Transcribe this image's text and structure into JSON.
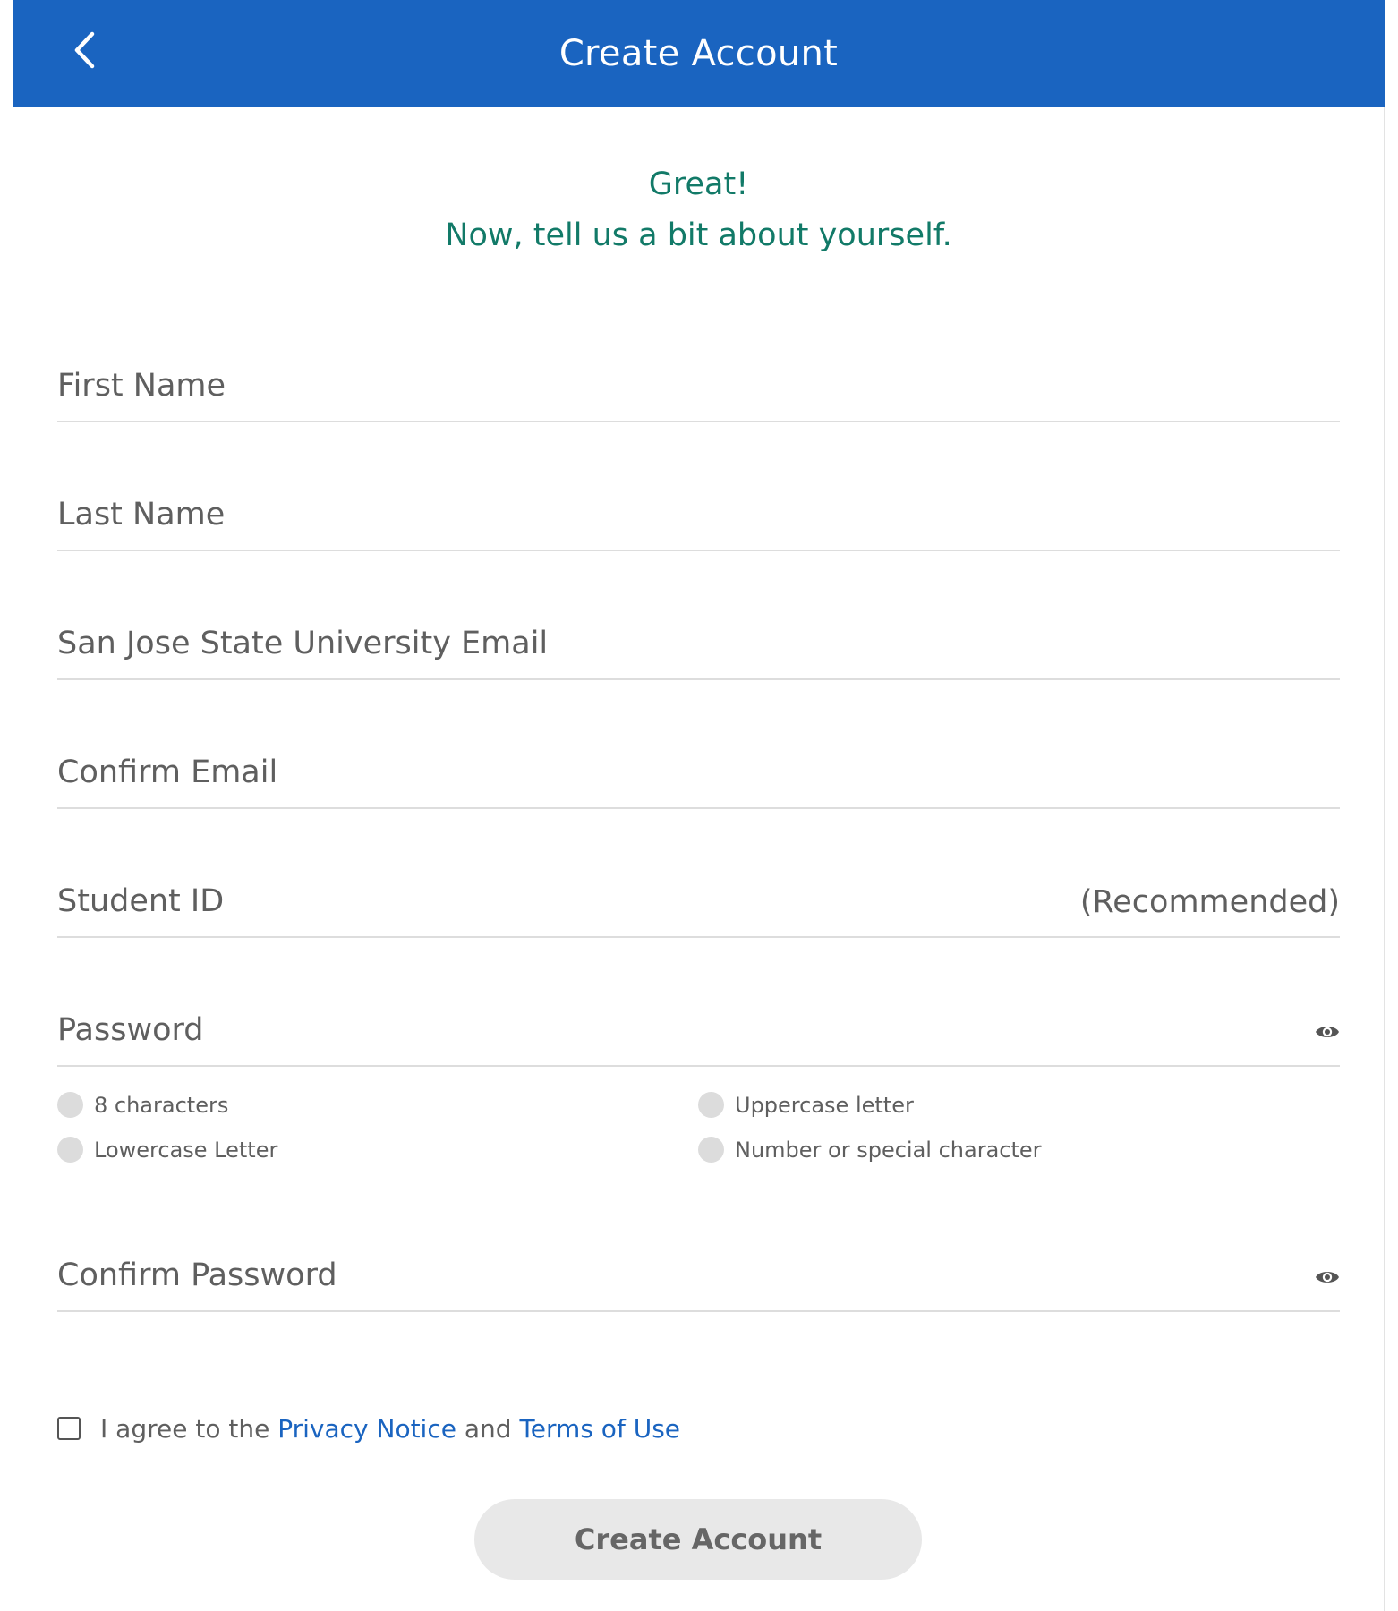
{
  "header": {
    "title": "Create Account",
    "back_icon": "chevron-left-icon",
    "background_color": "#1a64c0"
  },
  "intro": {
    "line1": "Great!",
    "line2": "Now, tell us a bit about yourself.",
    "color": "#127a68"
  },
  "form": {
    "first_name": {
      "placeholder": "First Name",
      "value": ""
    },
    "last_name": {
      "placeholder": "Last Name",
      "value": ""
    },
    "email": {
      "placeholder": "San Jose State University Email",
      "value": ""
    },
    "confirm_email": {
      "placeholder": "Confirm Email",
      "value": ""
    },
    "student_id": {
      "placeholder": "Student ID",
      "value": "",
      "hint": "(Recommended)"
    },
    "password": {
      "placeholder": "Password",
      "value": "",
      "toggle_icon": "eye-icon"
    },
    "confirm_password": {
      "placeholder": "Confirm Password",
      "value": "",
      "toggle_icon": "eye-icon"
    }
  },
  "password_requirements": [
    {
      "label": "8 characters",
      "met": false
    },
    {
      "label": "Uppercase letter",
      "met": false
    },
    {
      "label": "Lowercase Letter",
      "met": false
    },
    {
      "label": "Number or special character",
      "met": false
    }
  ],
  "agreement": {
    "checked": false,
    "prefix": "I agree to the",
    "privacy_link": "Privacy Notice",
    "conjunction": "and",
    "terms_link": "Terms of Use",
    "link_color": "#1a64c0"
  },
  "submit": {
    "label": "Create Account",
    "disabled": true
  }
}
